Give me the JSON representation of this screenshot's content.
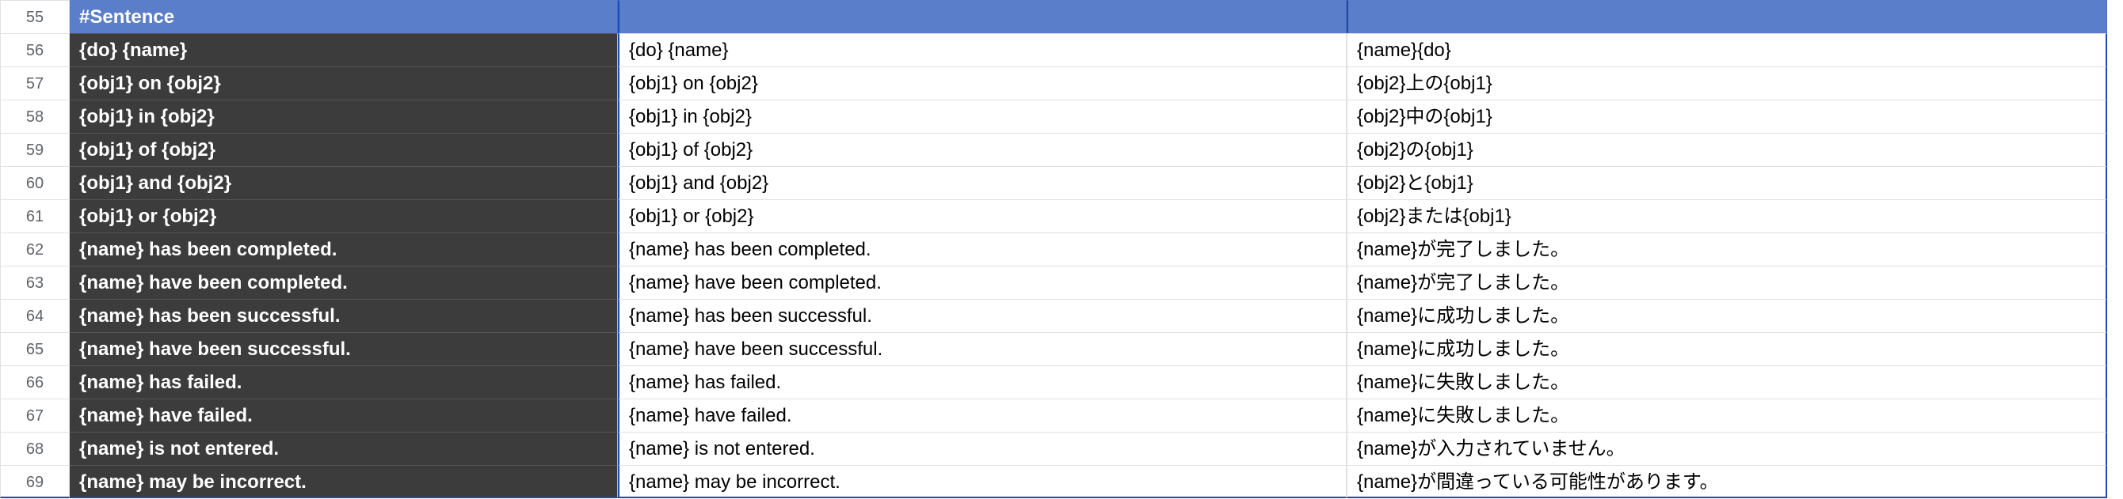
{
  "header": {
    "rownum": "55",
    "a": "#Sentence",
    "b": "",
    "c": ""
  },
  "rows": [
    {
      "num": "56",
      "a": "{do} {name}",
      "b": "{do} {name}",
      "c": "{name}{do}"
    },
    {
      "num": "57",
      "a": "{obj1} on {obj2}",
      "b": "{obj1} on {obj2}",
      "c": "{obj2}上の{obj1}"
    },
    {
      "num": "58",
      "a": "{obj1} in {obj2}",
      "b": "{obj1} in {obj2}",
      "c": "{obj2}中の{obj1}"
    },
    {
      "num": "59",
      "a": "{obj1} of {obj2}",
      "b": "{obj1} of {obj2}",
      "c": "{obj2}の{obj1}"
    },
    {
      "num": "60",
      "a": "{obj1} and {obj2}",
      "b": "{obj1} and {obj2}",
      "c": "{obj2}と{obj1}"
    },
    {
      "num": "61",
      "a": "{obj1} or {obj2}",
      "b": "{obj1} or {obj2}",
      "c": "{obj2}または{obj1}"
    },
    {
      "num": "62",
      "a": "{name} has been completed.",
      "b": "{name} has been completed.",
      "c": "{name}が完了しました。"
    },
    {
      "num": "63",
      "a": "{name} have been completed.",
      "b": "{name} have been completed.",
      "c": "{name}が完了しました。"
    },
    {
      "num": "64",
      "a": "{name} has been successful.",
      "b": "{name} has been successful.",
      "c": "{name}に成功しました。"
    },
    {
      "num": "65",
      "a": "{name} have been successful.",
      "b": "{name} have been successful.",
      "c": "{name}に成功しました。"
    },
    {
      "num": "66",
      "a": "{name} has failed.",
      "b": "{name} has failed.",
      "c": "{name}に失敗しました。"
    },
    {
      "num": "67",
      "a": "{name} have failed.",
      "b": "{name} have failed.",
      "c": "{name}に失敗しました。"
    },
    {
      "num": "68",
      "a": "{name} is not entered.",
      "b": "{name} is not entered.",
      "c": "{name}が入力されていません。"
    },
    {
      "num": "69",
      "a": "{name} may be incorrect.",
      "b": "{name} may be incorrect.",
      "c": "{name}が間違っている可能性があります。"
    }
  ]
}
